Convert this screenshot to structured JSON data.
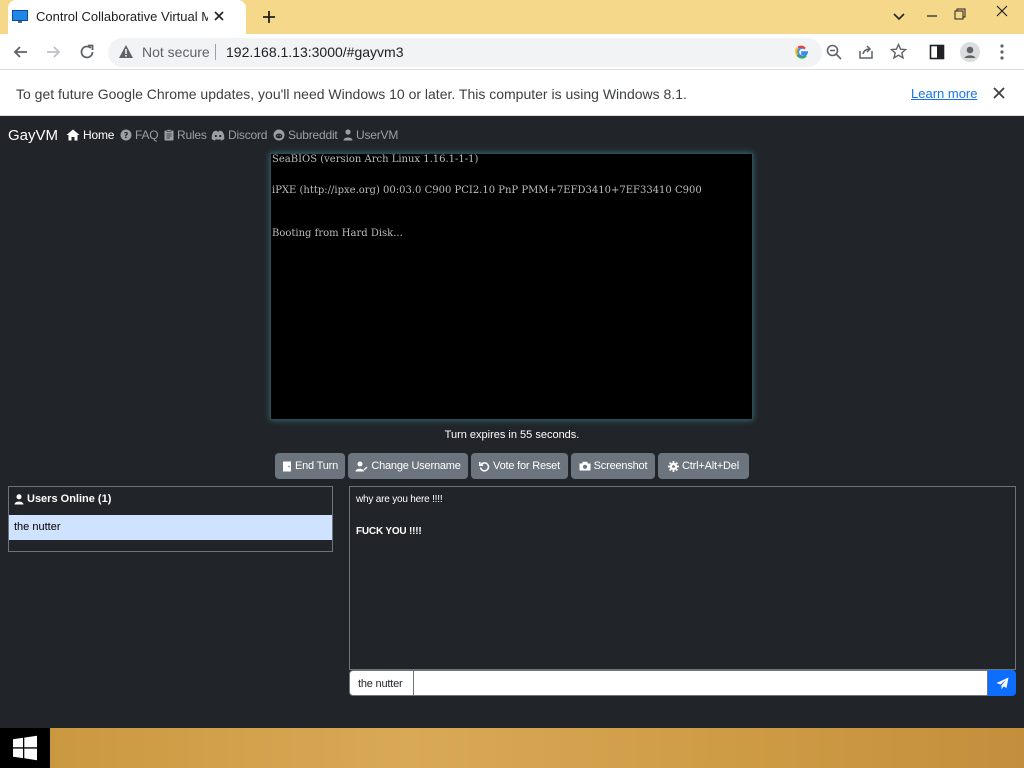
{
  "browser": {
    "tab_title": "Control Collaborative Virtual Ma",
    "not_secure_label": "Not secure",
    "url": "192.168.1.13:3000/#gayvm3",
    "infobar_text": "To get future Google Chrome updates, you'll need Windows 10 or later. This computer is using Windows 8.1.",
    "learn_more": "Learn more"
  },
  "nav": {
    "brand": "GayVM",
    "items": [
      {
        "label": "Home",
        "icon": "home-icon",
        "active": true
      },
      {
        "label": "FAQ",
        "icon": "question-circle-icon"
      },
      {
        "label": "Rules",
        "icon": "clipboard-icon"
      },
      {
        "label": "Discord",
        "icon": "discord-icon"
      },
      {
        "label": "Subreddit",
        "icon": "reddit-icon"
      },
      {
        "label": "UserVM",
        "icon": "user-icon"
      }
    ]
  },
  "vm": {
    "lines": [
      "SeaBIOS (version Arch Linux 1.16.1-1-1)",
      "iPXE (http://ipxe.org) 00:03.0 C900 PCI2.10 PnP PMM+7EFD3410+7EF33410 C900",
      "Booting from Hard Disk..."
    ],
    "turn_text": "Turn expires in 55 seconds."
  },
  "controls": [
    {
      "label": "End Turn",
      "icon": "door-icon"
    },
    {
      "label": "Change Username",
      "icon": "user-edit-icon"
    },
    {
      "label": "Vote for Reset",
      "icon": "undo-icon"
    },
    {
      "label": "Screenshot",
      "icon": "camera-icon"
    },
    {
      "label": "Ctrl+Alt+Del",
      "icon": "gear-icon"
    }
  ],
  "users": {
    "header": "Users Online (1)",
    "list": [
      "the nutter"
    ]
  },
  "chat": {
    "messages": [
      {
        "text": "why are you here !!!!",
        "bold": false
      },
      {
        "text": "FUCK YOU !!!!",
        "bold": true
      }
    ],
    "username": "the nutter",
    "input_value": ""
  },
  "colors": {
    "tabbar": "#f6d88a",
    "page_bg": "#212529",
    "button_gray": "#6c757d",
    "user_row": "#cfe2ff",
    "send_blue": "#0d6efd"
  }
}
